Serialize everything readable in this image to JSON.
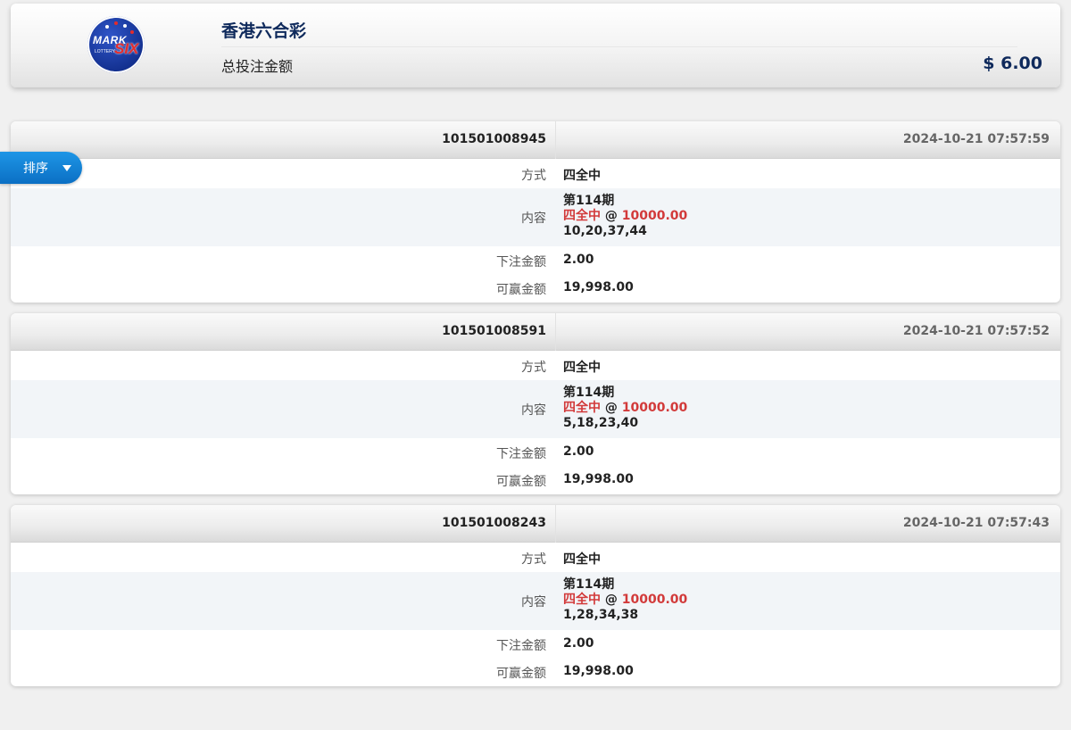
{
  "header": {
    "logo": {
      "name": "mark-six-logo",
      "text_mark": "MARK",
      "text_six": "SIX",
      "text_lottery": "LOTTERY"
    },
    "title": "香港六合彩",
    "total_label": "总投注金额",
    "total_amount": "$ 6.00"
  },
  "sort_button": {
    "label": "排序",
    "icon": "triangle-down-icon"
  },
  "labels": {
    "way": "方式",
    "content": "内容",
    "amount": "下注金额",
    "winnable": "可赢金额"
  },
  "colors": {
    "accent_blue": "#0b6fc4",
    "title_navy": "#0f2a5c",
    "highlight_red": "#d23a3a"
  },
  "bets": [
    {
      "id": "101501008945",
      "time": "2024-10-21 07:57:59",
      "way": "四全中",
      "period": "第114期",
      "play": "四全中",
      "at": "@",
      "odds": "10000.00",
      "numbers": "10,20,37,44",
      "amount": "2.00",
      "winnable": "19,998.00"
    },
    {
      "id": "101501008591",
      "time": "2024-10-21 07:57:52",
      "way": "四全中",
      "period": "第114期",
      "play": "四全中",
      "at": "@",
      "odds": "10000.00",
      "numbers": "5,18,23,40",
      "amount": "2.00",
      "winnable": "19,998.00"
    },
    {
      "id": "101501008243",
      "time": "2024-10-21 07:57:43",
      "way": "四全中",
      "period": "第114期",
      "play": "四全中",
      "at": "@",
      "odds": "10000.00",
      "numbers": "1,28,34,38",
      "amount": "2.00",
      "winnable": "19,998.00"
    }
  ]
}
